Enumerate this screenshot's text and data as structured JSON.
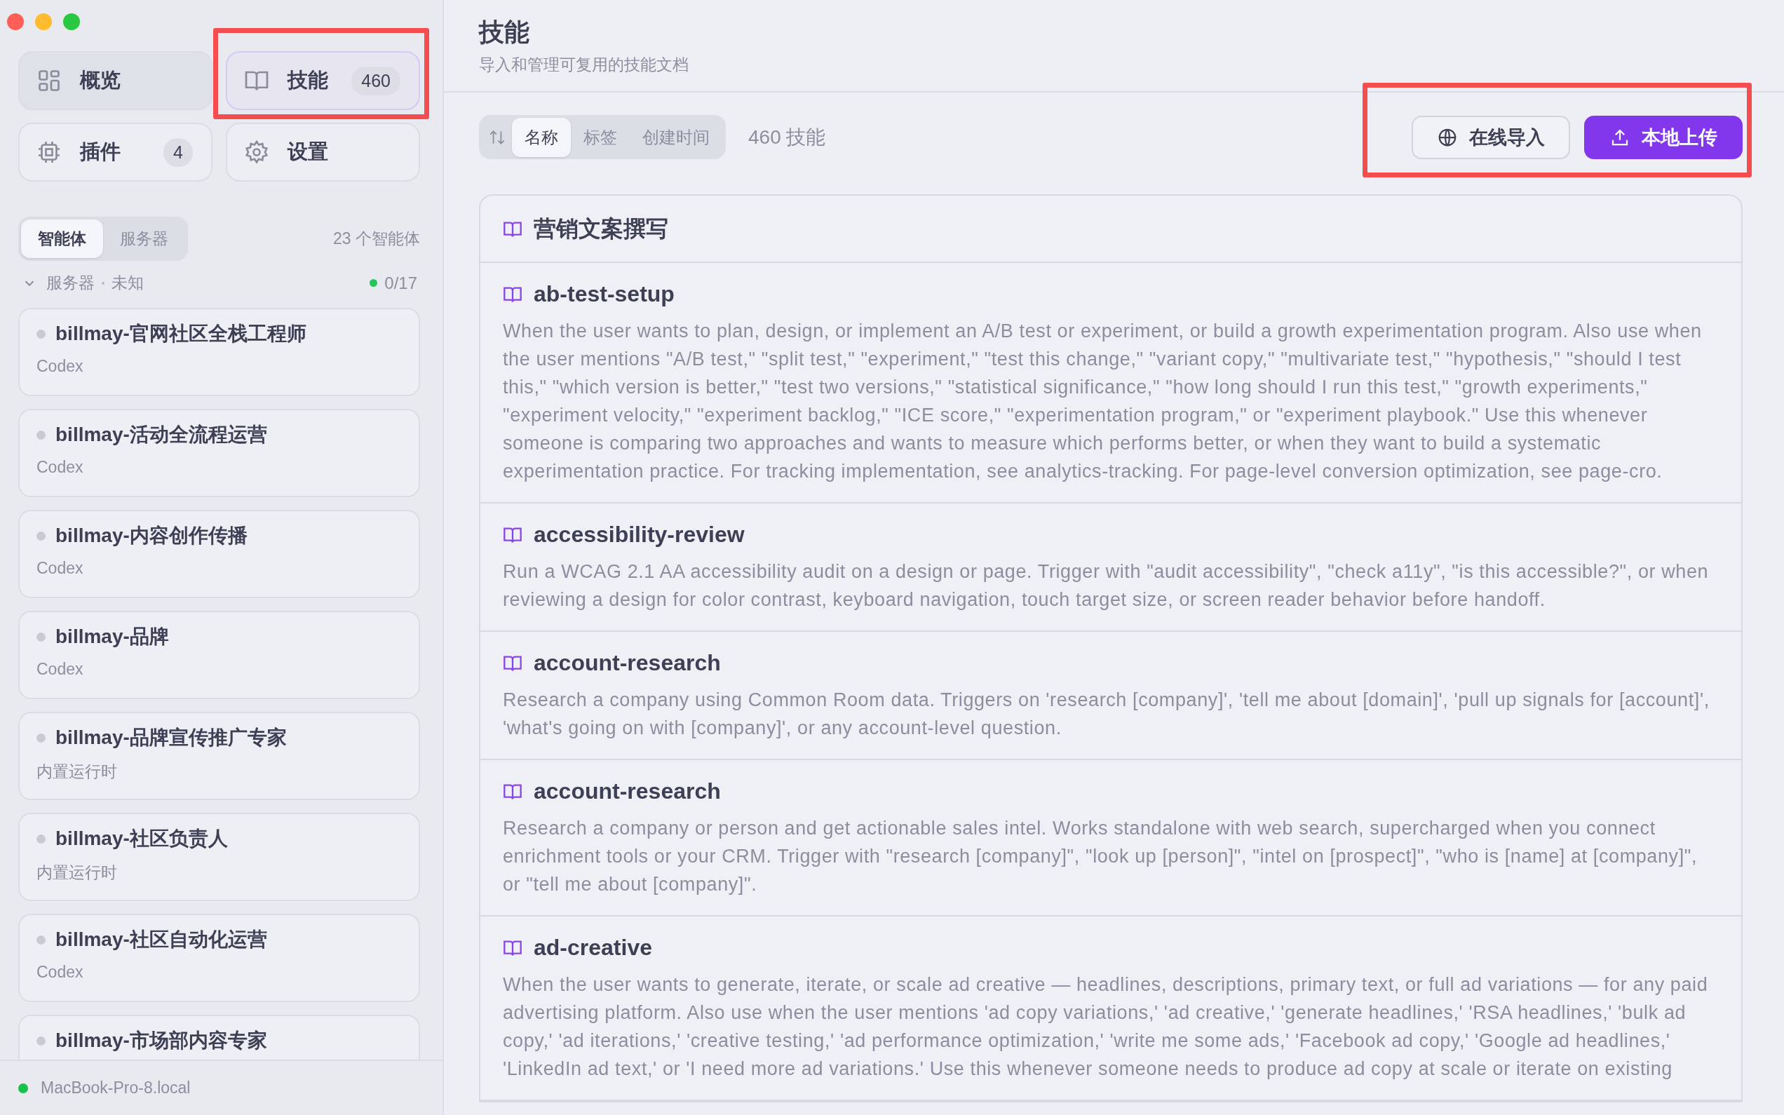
{
  "nav": [
    {
      "label": "概览",
      "kind": "grid",
      "selected": false,
      "hovered": true,
      "highlighted": false
    },
    {
      "label": "技能",
      "kind": "book",
      "badge": "460",
      "selected": true,
      "hovered": false,
      "highlighted": true
    },
    {
      "label": "插件",
      "kind": "chip",
      "badge": "4",
      "selected": false,
      "hovered": false,
      "highlighted": false
    },
    {
      "label": "设置",
      "kind": "gear",
      "selected": false,
      "hovered": false,
      "highlighted": false
    }
  ],
  "agent_tabs": [
    {
      "label": "智能体",
      "selected": true
    },
    {
      "label": "服务器",
      "selected": false
    }
  ],
  "agent_count": "23 个智能体",
  "group": {
    "label": "服务器",
    "status": "未知",
    "expanded": true,
    "online": "0/17",
    "color": "#22c55e"
  },
  "agents": [
    {
      "name": "billmay-官网社区全栈工程师",
      "runtime": "Codex"
    },
    {
      "name": "billmay-活动全流程运营",
      "runtime": "Codex"
    },
    {
      "name": "billmay-内容创作传播",
      "runtime": "Codex"
    },
    {
      "name": "billmay-品牌",
      "runtime": "Codex"
    },
    {
      "name": "billmay-品牌宣传推广专家",
      "runtime": "内置运行时"
    },
    {
      "name": "billmay-社区负责人",
      "runtime": "内置运行时"
    },
    {
      "name": "billmay-社区自动化运营",
      "runtime": "Codex"
    },
    {
      "name": "billmay-市场部内容专家"
    }
  ],
  "footer": {
    "host": "MacBook-Pro-8.local",
    "online": true
  },
  "header": {
    "title": "技能",
    "subtitle": "导入和管理可复用的技能文档"
  },
  "sort": {
    "options": [
      {
        "label": "名称",
        "selected": true
      },
      {
        "label": "标签",
        "selected": false
      },
      {
        "label": "创建时间",
        "selected": false
      }
    ]
  },
  "count": "460 技能",
  "actions": {
    "highlighted": true,
    "buttons": [
      {
        "label": "在线导入",
        "kind": "outline"
      },
      {
        "label": "本地上传",
        "kind": "primary"
      }
    ]
  },
  "skills": [
    {
      "name": "营销文案撰写"
    },
    {
      "name": "ab-test-setup",
      "description": "When the user wants to plan, design, or implement an A/B test or experiment, or build a growth experimentation program. Also use when the user mentions \"A/B test,\" \"split test,\" \"experiment,\" \"test this change,\" \"variant copy,\" \"multivariate test,\" \"hypothesis,\" \"should I test this,\" \"which version is better,\" \"test two versions,\" \"statistical significance,\" \"how long should I run this test,\" \"growth experiments,\" \"experiment velocity,\" \"experiment backlog,\" \"ICE score,\" \"experimentation program,\" or \"experiment playbook.\" Use this whenever someone is comparing two approaches and wants to measure which performs better, or when they want to build a systematic experimentation practice. For tracking implementation, see analytics-tracking. For page-level conversion optimization, see page-cro."
    },
    {
      "name": "accessibility-review",
      "description": "Run a WCAG 2.1 AA accessibility audit on a design or page. Trigger with \"audit accessibility\", \"check a11y\", \"is this accessible?\", or when reviewing a design for color contrast, keyboard navigation, touch target size, or screen reader behavior before handoff."
    },
    {
      "name": "account-research",
      "description": "Research a company using Common Room data. Triggers on 'research [company]', 'tell me about [domain]', 'pull up signals for [account]', 'what's going on with [company]', or any account-level question."
    },
    {
      "name": "account-research",
      "description": "Research a company or person and get actionable sales intel. Works standalone with web search, supercharged when you connect enrichment tools or your CRM. Trigger with \"research [company]\", \"look up [person]\", \"intel on [prospect]\", \"who is [name] at [company]\", or \"tell me about [company]\"."
    },
    {
      "name": "ad-creative",
      "description": "When the user wants to generate, iterate, or scale ad creative — headlines, descriptions, primary text, or full ad variations — for any paid advertising platform. Also use when the user mentions 'ad copy variations,' 'ad creative,' 'generate headlines,' 'RSA headlines,' 'bulk ad copy,' 'ad iterations,' 'creative testing,' 'ad performance optimization,' 'write me some ads,' 'Facebook ad copy,' 'Google ad headlines,' 'LinkedIn ad text,' or 'I need more ad variations.' Use this whenever someone needs to produce ad copy at scale or iterate on existing"
    }
  ]
}
